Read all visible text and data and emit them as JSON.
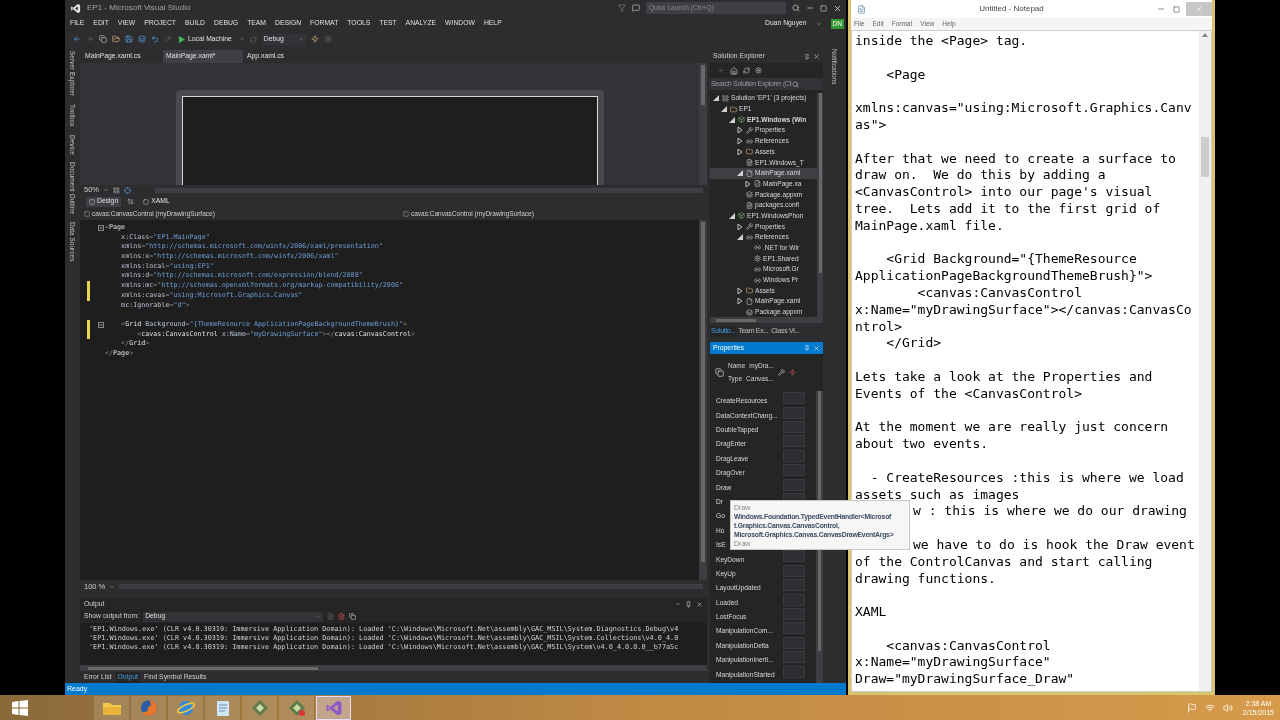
{
  "vs": {
    "title": "EP1 - Microsoft Visual Studio",
    "quick_launch": {
      "placeholder": "Quick Launch (Ctrl+Q)"
    },
    "menu": [
      "FILE",
      "EDIT",
      "VIEW",
      "PROJECT",
      "BUILD",
      "DEBUG",
      "TEAM",
      "DESIGN",
      "FORMAT",
      "TOOLS",
      "TEST",
      "ANALYZE",
      "WINDOW",
      "HELP"
    ],
    "user": {
      "name": "Duan Nguyen",
      "initials": "DN"
    },
    "toolbar": {
      "run_target": "Local Machine",
      "configuration": "Debug"
    },
    "side_tabs_left": [
      "Server Explorer",
      "Toolbox",
      "Device",
      "Document Outline",
      "Data Sources"
    ],
    "side_tabs_right": [
      "Notifications"
    ],
    "doc_tabs": [
      {
        "label": "MainPage.xaml.cs",
        "selected": false
      },
      {
        "label": "MainPage.xaml*",
        "selected": true
      },
      {
        "label": "App.xaml.cs",
        "selected": false
      }
    ],
    "designer": {
      "zoom": "50%",
      "view_tabs": [
        {
          "label": "Design",
          "selected": true
        },
        {
          "label": "XAML",
          "selected": false
        }
      ],
      "breadcrumbs": [
        "cavas:CanvasControl (myDrawingSurface)",
        "cavas:CanvasControl (myDrawingSurface)"
      ]
    },
    "code": {
      "zoom": "100 %",
      "lines": [
        {
          "foldable": true,
          "changed": false,
          "segments": [
            {
              "kind": "punct",
              "text": "<"
            },
            {
              "kind": "element",
              "text": "Page"
            }
          ]
        },
        {
          "foldable": false,
          "changed": false,
          "segments": [
            {
              "kind": "attr",
              "text": "    x:Class"
            },
            {
              "kind": "punct",
              "text": "="
            },
            {
              "kind": "value",
              "text": "\"EP1.MainPage\""
            }
          ]
        },
        {
          "foldable": false,
          "changed": false,
          "segments": [
            {
              "kind": "attr",
              "text": "    xmlns"
            },
            {
              "kind": "punct",
              "text": "="
            },
            {
              "kind": "value",
              "text": "\"http://schemas.microsoft.com/winfx/2006/xaml/presentation\""
            }
          ]
        },
        {
          "foldable": false,
          "changed": false,
          "segments": [
            {
              "kind": "attr",
              "text": "    xmlns:x"
            },
            {
              "kind": "punct",
              "text": "="
            },
            {
              "kind": "value",
              "text": "\"http://schemas.microsoft.com/winfx/2006/xaml\""
            }
          ]
        },
        {
          "foldable": false,
          "changed": false,
          "segments": [
            {
              "kind": "attr",
              "text": "    xmlns:local"
            },
            {
              "kind": "punct",
              "text": "="
            },
            {
              "kind": "value",
              "text": "\"using:EP1\""
            }
          ]
        },
        {
          "foldable": false,
          "changed": false,
          "segments": [
            {
              "kind": "attr",
              "text": "    xmlns:d"
            },
            {
              "kind": "punct",
              "text": "="
            },
            {
              "kind": "value",
              "text": "\"http://schemas.microsoft.com/expression/blend/2008\""
            }
          ]
        },
        {
          "foldable": false,
          "changed": true,
          "segments": [
            {
              "kind": "attr",
              "text": "    xmlns:mc"
            },
            {
              "kind": "punct",
              "text": "="
            },
            {
              "kind": "value",
              "text": "\"http://schemas.openxmlformats.org/markup-compatibility/2006\""
            }
          ]
        },
        {
          "foldable": false,
          "changed": true,
          "segments": [
            {
              "kind": "attr",
              "text": "    xmlns:cavas"
            },
            {
              "kind": "punct",
              "text": "="
            },
            {
              "kind": "value",
              "text": "\"using:Microsoft.Graphics.Canvas\""
            }
          ]
        },
        {
          "foldable": false,
          "changed": false,
          "segments": [
            {
              "kind": "attr",
              "text": "    mc:Ignorable"
            },
            {
              "kind": "punct",
              "text": "="
            },
            {
              "kind": "value",
              "text": "\"d\""
            },
            {
              "kind": "punct",
              "text": ">"
            }
          ]
        },
        {
          "foldable": false,
          "changed": false
        },
        {
          "foldable": true,
          "changed": true,
          "segments": [
            {
              "kind": "punct",
              "text": "    <"
            },
            {
              "kind": "element",
              "text": "Grid"
            },
            {
              "kind": "attr",
              "text": " Background"
            },
            {
              "kind": "punct",
              "text": "="
            },
            {
              "kind": "value",
              "text": "\"{ThemeResource ApplicationPageBackgroundThemeBrush}\""
            },
            {
              "kind": "punct",
              "text": ">"
            }
          ]
        },
        {
          "foldable": false,
          "changed": true,
          "segments": [
            {
              "kind": "punct",
              "text": "        <"
            },
            {
              "kind": "element",
              "text": "cavas:CanvasControl"
            },
            {
              "kind": "attr",
              "text": " x:Name"
            },
            {
              "kind": "punct",
              "text": "="
            },
            {
              "kind": "value",
              "text": "\"myDrawingSurface\""
            },
            {
              "kind": "punct",
              "text": "></"
            },
            {
              "kind": "element",
              "text": "cavas:CanvasControl"
            },
            {
              "kind": "punct",
              "text": ">"
            }
          ]
        },
        {
          "foldable": false,
          "changed": false,
          "segments": [
            {
              "kind": "punct",
              "text": "    </"
            },
            {
              "kind": "element",
              "text": "Grid"
            },
            {
              "kind": "punct",
              "text": ">"
            }
          ]
        },
        {
          "foldable": false,
          "changed": false,
          "segments": [
            {
              "kind": "punct",
              "text": "</"
            },
            {
              "kind": "element",
              "text": "Page"
            },
            {
              "kind": "punct",
              "text": ">"
            }
          ]
        }
      ]
    },
    "output": {
      "title": "Output",
      "source_label": "Show output from:",
      "source": "Debug",
      "lines": [
        "'EP1.Windows.exe' (CLR v4.0.30319: Immersive Application Domain): Loaded 'C:\\Windows\\Microsoft.Net\\assembly\\GAC_MSIL\\System.Diagnostics.Debug\\v4",
        "'EP1.Windows.exe' (CLR v4.0.30319: Immersive Application Domain): Loaded 'C:\\Windows\\Microsoft.Net\\assembly\\GAC_MSIL\\System.Collections\\v4.0_4.0",
        "'EP1.Windows.exe' (CLR v4.0.30319: Immersive Application Domain): Loaded 'C:\\Windows\\Microsoft.Net\\assembly\\GAC_MSIL\\System\\v4.0_4.0.0.0__b77a5c"
      ],
      "tabs": [
        {
          "label": "Error List",
          "selected": false
        },
        {
          "label": "Output",
          "selected": true
        },
        {
          "label": "Find Symbol Results",
          "selected": false
        }
      ]
    },
    "solution_explorer": {
      "title": "Solution Explorer",
      "search": {
        "placeholder": "Search Solution Explorer (Ct"
      },
      "tree": [
        {
          "label": "Solution 'EP1' (3 projects)",
          "kind": "solution",
          "expanded": true,
          "selected": false,
          "children": [
            {
              "label": "EP1",
              "kind": "folder",
              "expanded": true,
              "selected": false,
              "children": [
                {
                  "label": "EP1.Windows (Win",
                  "kind": "project",
                  "startup": true,
                  "expanded": true,
                  "selected": false,
                  "children": [
                    {
                      "label": "Properties",
                      "kind": "properties",
                      "expanded": false,
                      "selected": false
                    },
                    {
                      "label": "References",
                      "kind": "references",
                      "expanded": false,
                      "selected": false
                    },
                    {
                      "label": "Assets",
                      "kind": "folder",
                      "expanded": false,
                      "selected": false
                    },
                    {
                      "label": "EP1.Windows_T",
                      "kind": "certificate",
                      "selected": false
                    },
                    {
                      "label": "MainPage.xaml",
                      "kind": "xaml",
                      "expanded": true,
                      "selected": true,
                      "children": [
                        {
                          "label": "MainPage.xa",
                          "kind": "code",
                          "expanded": false,
                          "selected": false
                        }
                      ]
                    },
                    {
                      "label": "Package.appxm",
                      "kind": "manifest",
                      "selected": false
                    },
                    {
                      "label": "packages.confi",
                      "kind": "config",
                      "selected": false
                    }
                  ]
                },
                {
                  "label": "EP1.WindowsPhon",
                  "kind": "project",
                  "startup": false,
                  "expanded": true,
                  "selected": false,
                  "children": [
                    {
                      "label": "Properties",
                      "kind": "properties",
                      "expanded": false,
                      "selected": false
                    },
                    {
                      "label": "References",
                      "kind": "references",
                      "expanded": true,
                      "selected": false,
                      "children": [
                        {
                          "label": ".NET for Wir",
                          "kind": "reference",
                          "selected": false
                        },
                        {
                          "label": "EP1.Shared",
                          "kind": "shared",
                          "selected": false
                        },
                        {
                          "label": "Microsoft.Gr",
                          "kind": "reference",
                          "selected": false
                        },
                        {
                          "label": "Windows Pr",
                          "kind": "reference",
                          "selected": false
                        }
                      ]
                    },
                    {
                      "label": "Assets",
                      "kind": "folder",
                      "expanded": false,
                      "selected": false
                    },
                    {
                      "label": "MainPage.xaml",
                      "kind": "xaml",
                      "expanded": false,
                      "selected": false
                    },
                    {
                      "label": "Package.appxm",
                      "kind": "manifest",
                      "selected": false
                    }
                  ]
                }
              ]
            }
          ]
        }
      ],
      "tabs": [
        {
          "label": "Solutio...",
          "selected": true
        },
        {
          "label": "Team Ex...",
          "selected": false
        },
        {
          "label": "Class Vi...",
          "selected": false
        }
      ]
    },
    "properties": {
      "title": "Properties",
      "name_label": "Name",
      "name_value": "myDra...",
      "type_label": "Type",
      "type_value": "Canvas...",
      "events": [
        "CreateResources",
        "DataContextChang...",
        "DoubleTapped",
        "DragEnter",
        "DragLeave",
        "DragOver",
        "Draw",
        "Dr",
        "Go",
        "Ho",
        "IsE",
        "KeyDown",
        "KeyUp",
        "LayoutUpdated",
        "Loaded",
        "LostFocus",
        "ManipulationCom...",
        "ManipulationDelta",
        "ManipulationInerti...",
        "ManipulationStarted"
      ]
    },
    "tooltip": {
      "title": "Draw",
      "lines": [
        "Windows.Foundation.TypedEventHandler<Microsof",
        "t.Graphics.Canvas.CanvasControl,",
        "Microsoft.Graphics.Canvas.CanvasDrawEventArgs>"
      ],
      "footer": "Draw"
    },
    "status_bar": "Ready"
  },
  "notepad": {
    "title": "Untitled - Notepad",
    "menu": [
      "File",
      "Edit",
      "Format",
      "View",
      "Help"
    ],
    "blocks": [
      [
        "inside the <Page> tag."
      ],
      [
        "    <Page"
      ],
      [
        "xmlns:canvas=\"using:Microsoft.Graphics.Canv",
        "as\">"
      ],
      [
        "After that we need to create a surface to",
        "draw on.  We do this by adding a",
        "<CanvasControl> into our page's visual",
        "tree.  Lets add it to the first grid of",
        "MainPage.xaml file."
      ],
      [
        "    <Grid Background=\"{ThemeResource",
        "ApplicationPageBackgroundThemeBrush}\">",
        "        <canvas:CanvasControl",
        "x:Name=\"myDrawingSurface\"></canvas:CanvasCo",
        "ntrol>",
        "    </Grid>"
      ],
      [
        "Lets take a look at the Properties and",
        "Events of the <CanvasControl>"
      ],
      [
        "At the moment we are really just concern",
        "about two events."
      ],
      [
        "  - CreateResources :this is where we load",
        "assets such as images",
        {
          "text": "w : this is where we do our drawing",
          "behind_tooltip": true
        }
      ],
      [
        {
          "text": "we have to do is hook the Draw event",
          "behind_tooltip": true
        },
        "of the ControlCanvas and start calling",
        "drawing functions."
      ],
      [
        "XAML"
      ],
      [
        "    <canvas:CanvasControl",
        "x:Name=\"myDrawingSurface\"",
        "Draw=\"myDrawingSurface_Draw\""
      ]
    ]
  },
  "taskbar": {
    "apps": [
      {
        "kind": "explorer",
        "selected": false
      },
      {
        "kind": "firefox",
        "selected": false
      },
      {
        "kind": "browser",
        "selected": false
      },
      {
        "kind": "notepad",
        "selected": false
      },
      {
        "kind": "app",
        "selected": false
      },
      {
        "kind": "app_alert",
        "selected": false
      },
      {
        "kind": "visual_studio",
        "selected": true
      }
    ],
    "time": "2:38 AM",
    "date": "2/15/2015"
  }
}
